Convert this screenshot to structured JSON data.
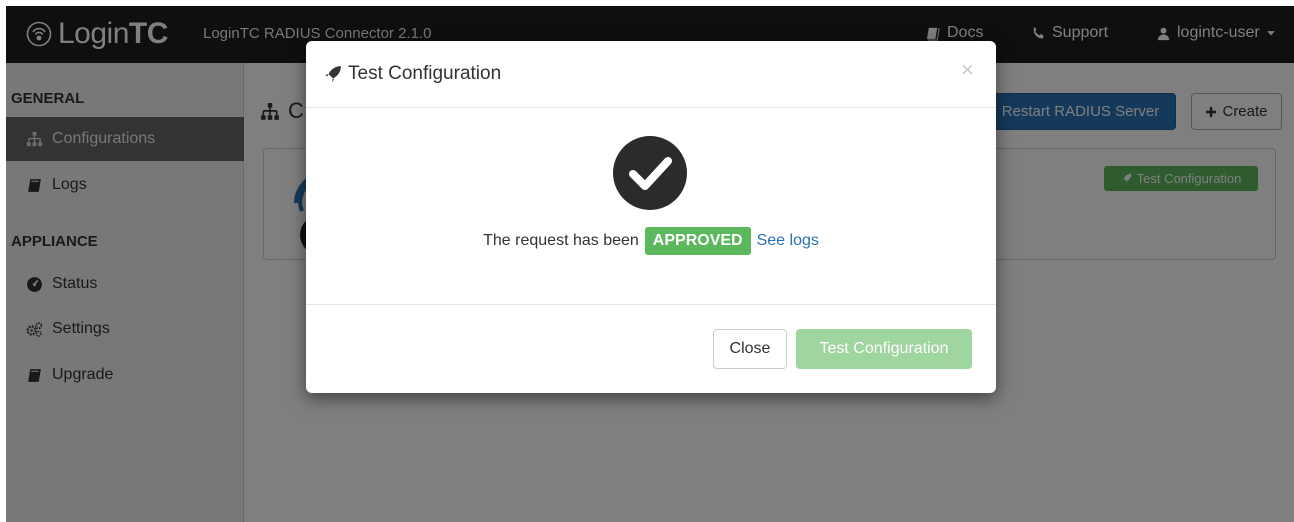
{
  "navbar": {
    "brand_login": "Login",
    "brand_tc": "TC",
    "app_title": "LoginTC RADIUS Connector 2.1.0",
    "docs_label": "Docs",
    "support_label": "Support",
    "user_label": "logintc-user"
  },
  "sidebar": {
    "general_heading": "GENERAL",
    "appliance_heading": "APPLIANCE",
    "items": [
      {
        "label": "Configurations",
        "icon": "sitemap-icon"
      },
      {
        "label": "Logs",
        "icon": "book-icon"
      },
      {
        "label": "Status",
        "icon": "dashboard-icon"
      },
      {
        "label": "Settings",
        "icon": "gears-icon"
      },
      {
        "label": "Upgrade",
        "icon": "book-icon"
      }
    ]
  },
  "main": {
    "title_visible": "C",
    "restart_label": "Restart RADIUS Server",
    "create_label": "Create",
    "test_config_label": "Test Configuration"
  },
  "modal": {
    "title": "Test Configuration",
    "close_glyph": "×",
    "result_prefix": "The request has been",
    "status_badge": "APPROVED",
    "see_logs": "See logs",
    "close_button": "Close",
    "test_button": "Test Configuration"
  },
  "colors": {
    "navbar_bg": "#1f1f1f",
    "primary_blue": "#2a73b6",
    "success_green": "#5cb85c",
    "disabled_green": "#9fd59f",
    "sidebar_active": "#666666"
  }
}
